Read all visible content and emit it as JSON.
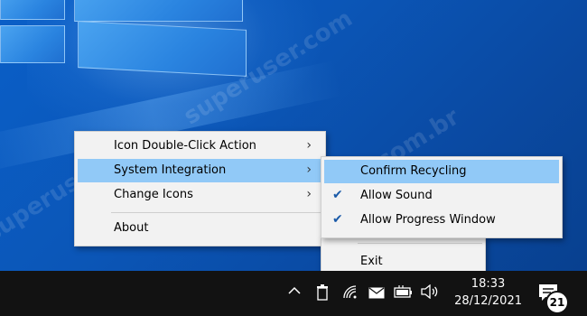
{
  "context_menu": {
    "items": [
      {
        "label": "Icon Double-Click Action",
        "has_submenu": true
      },
      {
        "label": "System Integration",
        "has_submenu": true,
        "highlighted": true
      },
      {
        "label": "Change Icons",
        "has_submenu": true
      },
      {
        "label": "About",
        "has_submenu": false
      }
    ]
  },
  "submenu": {
    "items": [
      {
        "label": "Confirm Recycling",
        "checked": false,
        "highlighted": true
      },
      {
        "label": "Allow Sound",
        "checked": true
      },
      {
        "label": "Allow Progress Window",
        "checked": true
      }
    ]
  },
  "exit_menu": {
    "label": "Exit"
  },
  "taskbar": {
    "clock_time": "18:33",
    "clock_date": "28/12/2021",
    "notification_count": "21",
    "icons": [
      "chevron-up-icon",
      "recycle-bin-icon",
      "wifi-icon",
      "mail-icon",
      "battery-icon",
      "speaker-icon",
      "action-center-icon"
    ]
  },
  "watermark": {
    "text": "superuser.com",
    "text2": "superuser.com.br"
  },
  "colors": {
    "highlight": "#91c9f7",
    "menu_bg": "#f2f2f2",
    "taskbar_bg": "#121212",
    "check": "#1a5aa8"
  }
}
